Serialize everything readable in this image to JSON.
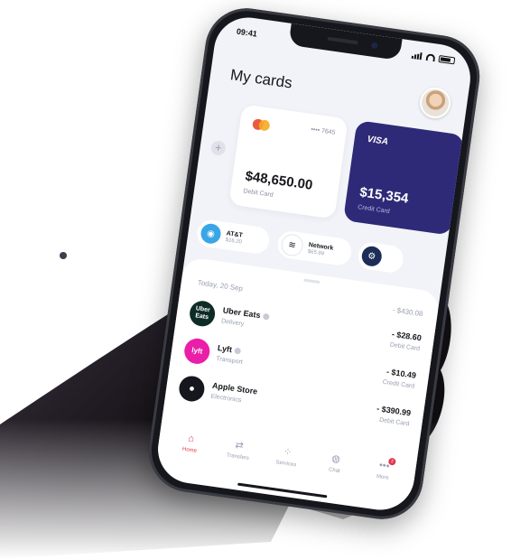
{
  "status_bar": {
    "time": "09:41"
  },
  "header": {
    "title": "My cards"
  },
  "cards": [
    {
      "network": "mastercard",
      "number": "•••• 7645",
      "balance": "$48,650.00",
      "type": "Debit Card"
    },
    {
      "network": "VISA",
      "balance": "$15,354",
      "type": "Credit Card"
    }
  ],
  "add_card_icon": "+",
  "subscriptions": [
    {
      "name": "AT&T",
      "price": "$16.20",
      "icon": "att-icon"
    },
    {
      "name": "Network",
      "price": "$65.99",
      "icon": "wifi-icon"
    },
    {
      "name": "",
      "price": "",
      "icon": "steam-icon"
    }
  ],
  "transactions_section": {
    "date": "Today, 20 Sep",
    "total": "- $430.08"
  },
  "transactions": [
    {
      "name": "Uber Eats",
      "category": "Delivery",
      "amount": "- $28.60",
      "source": "Debit Card",
      "logo": "Uber Eats"
    },
    {
      "name": "Lyft",
      "category": "Transport",
      "amount": "- $10.49",
      "source": "Credit Card",
      "logo": "lyft"
    },
    {
      "name": "Apple Store",
      "category": "Electronics",
      "amount": "- $390.99",
      "source": "Debit Card",
      "logo": ""
    }
  ],
  "tabbar": {
    "items": [
      {
        "label": "Home",
        "icon": "home-icon",
        "active": true
      },
      {
        "label": "Transfers",
        "icon": "transfer-icon"
      },
      {
        "label": "Services",
        "icon": "grid-icon"
      },
      {
        "label": "Chat",
        "icon": "chat-icon"
      },
      {
        "label": "More",
        "icon": "more-icon",
        "badge": "2"
      }
    ]
  },
  "colors": {
    "accent": "#e0344a",
    "credit_card": "#2f2a77",
    "background": "#f2f3f8"
  }
}
